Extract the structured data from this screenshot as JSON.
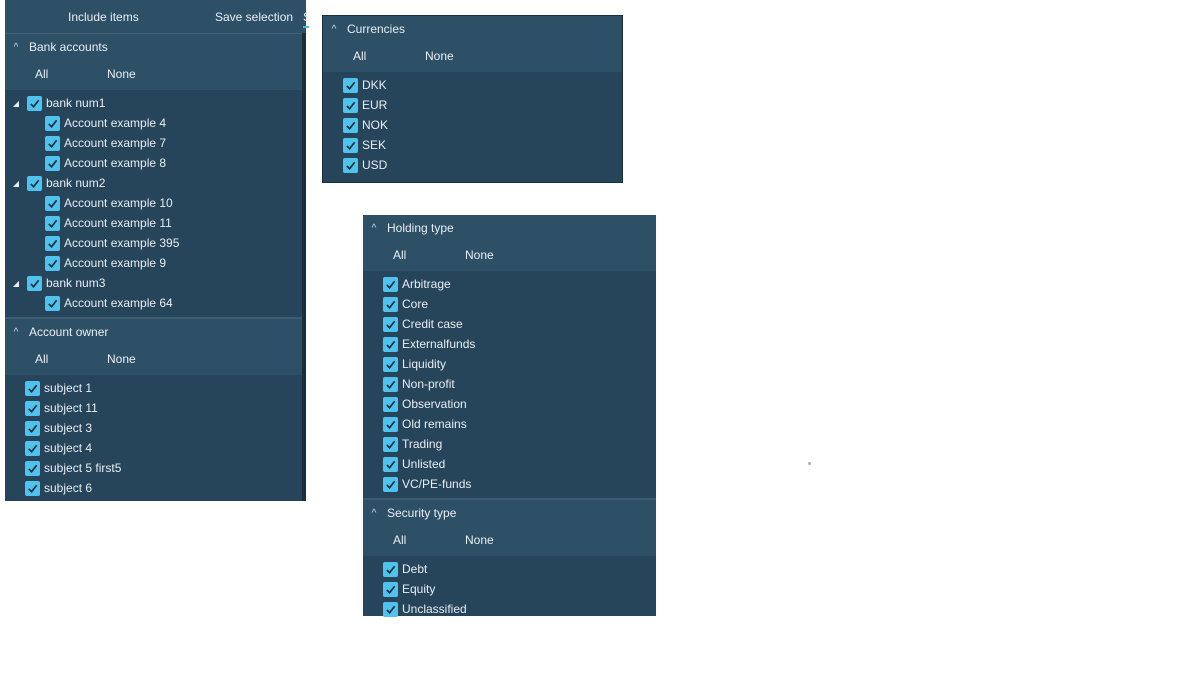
{
  "toolbar": {
    "include_items": "Include items",
    "save_selection": "Save selection",
    "clipped_tab": "S"
  },
  "all_label": "All",
  "none_label": "None",
  "colors": {
    "panel_bg": "#26445a",
    "header_bg": "#2d5066",
    "checkbox": "#4fc3ee"
  },
  "left_panel": {
    "sections": [
      {
        "title": "Bank accounts",
        "tree": true,
        "items": [
          {
            "label": "bank num1",
            "level": 0,
            "checked": true
          },
          {
            "label": "Account example 4",
            "level": 1,
            "checked": true
          },
          {
            "label": "Account example 7",
            "level": 1,
            "checked": true
          },
          {
            "label": "Account example 8",
            "level": 1,
            "checked": true
          },
          {
            "label": "bank num2",
            "level": 0,
            "checked": true
          },
          {
            "label": "Account example 10",
            "level": 1,
            "checked": true
          },
          {
            "label": "Account example 11",
            "level": 1,
            "checked": true
          },
          {
            "label": "Account example 395",
            "level": 1,
            "checked": true
          },
          {
            "label": "Account example 9",
            "level": 1,
            "checked": true
          },
          {
            "label": "bank num3",
            "level": 0,
            "checked": true
          },
          {
            "label": "Account example 64",
            "level": 1,
            "checked": true
          }
        ]
      },
      {
        "title": "Account owner",
        "tree": false,
        "items": [
          {
            "label": "subject 1",
            "checked": true
          },
          {
            "label": "subject 11",
            "checked": true
          },
          {
            "label": "subject 3",
            "checked": true
          },
          {
            "label": "subject 4",
            "checked": true
          },
          {
            "label": "subject 5 first5",
            "checked": true
          },
          {
            "label": "subject 6",
            "checked": true
          }
        ]
      }
    ]
  },
  "currency_panel": {
    "sections": [
      {
        "title": "Currencies",
        "tree": false,
        "items": [
          {
            "label": "DKK",
            "checked": true
          },
          {
            "label": "EUR",
            "checked": true
          },
          {
            "label": "NOK",
            "checked": true
          },
          {
            "label": "SEK",
            "checked": true
          },
          {
            "label": "USD",
            "checked": true
          }
        ]
      }
    ]
  },
  "holding_panel": {
    "sections": [
      {
        "title": "Holding type",
        "tree": false,
        "items": [
          {
            "label": "Arbitrage",
            "checked": true
          },
          {
            "label": "Core",
            "checked": true
          },
          {
            "label": "Credit case",
            "checked": true
          },
          {
            "label": "Externalfunds",
            "checked": true
          },
          {
            "label": "Liquidity",
            "checked": true
          },
          {
            "label": "Non-profit",
            "checked": true
          },
          {
            "label": "Observation",
            "checked": true
          },
          {
            "label": "Old remains",
            "checked": true
          },
          {
            "label": "Trading",
            "checked": true
          },
          {
            "label": "Unlisted",
            "checked": true
          },
          {
            "label": "VC/PE-funds",
            "checked": true
          }
        ]
      },
      {
        "title": "Security type",
        "tree": false,
        "items": [
          {
            "label": "Debt",
            "checked": true
          },
          {
            "label": "Equity",
            "checked": true
          },
          {
            "label": "Unclassified",
            "checked": true
          }
        ]
      }
    ]
  }
}
